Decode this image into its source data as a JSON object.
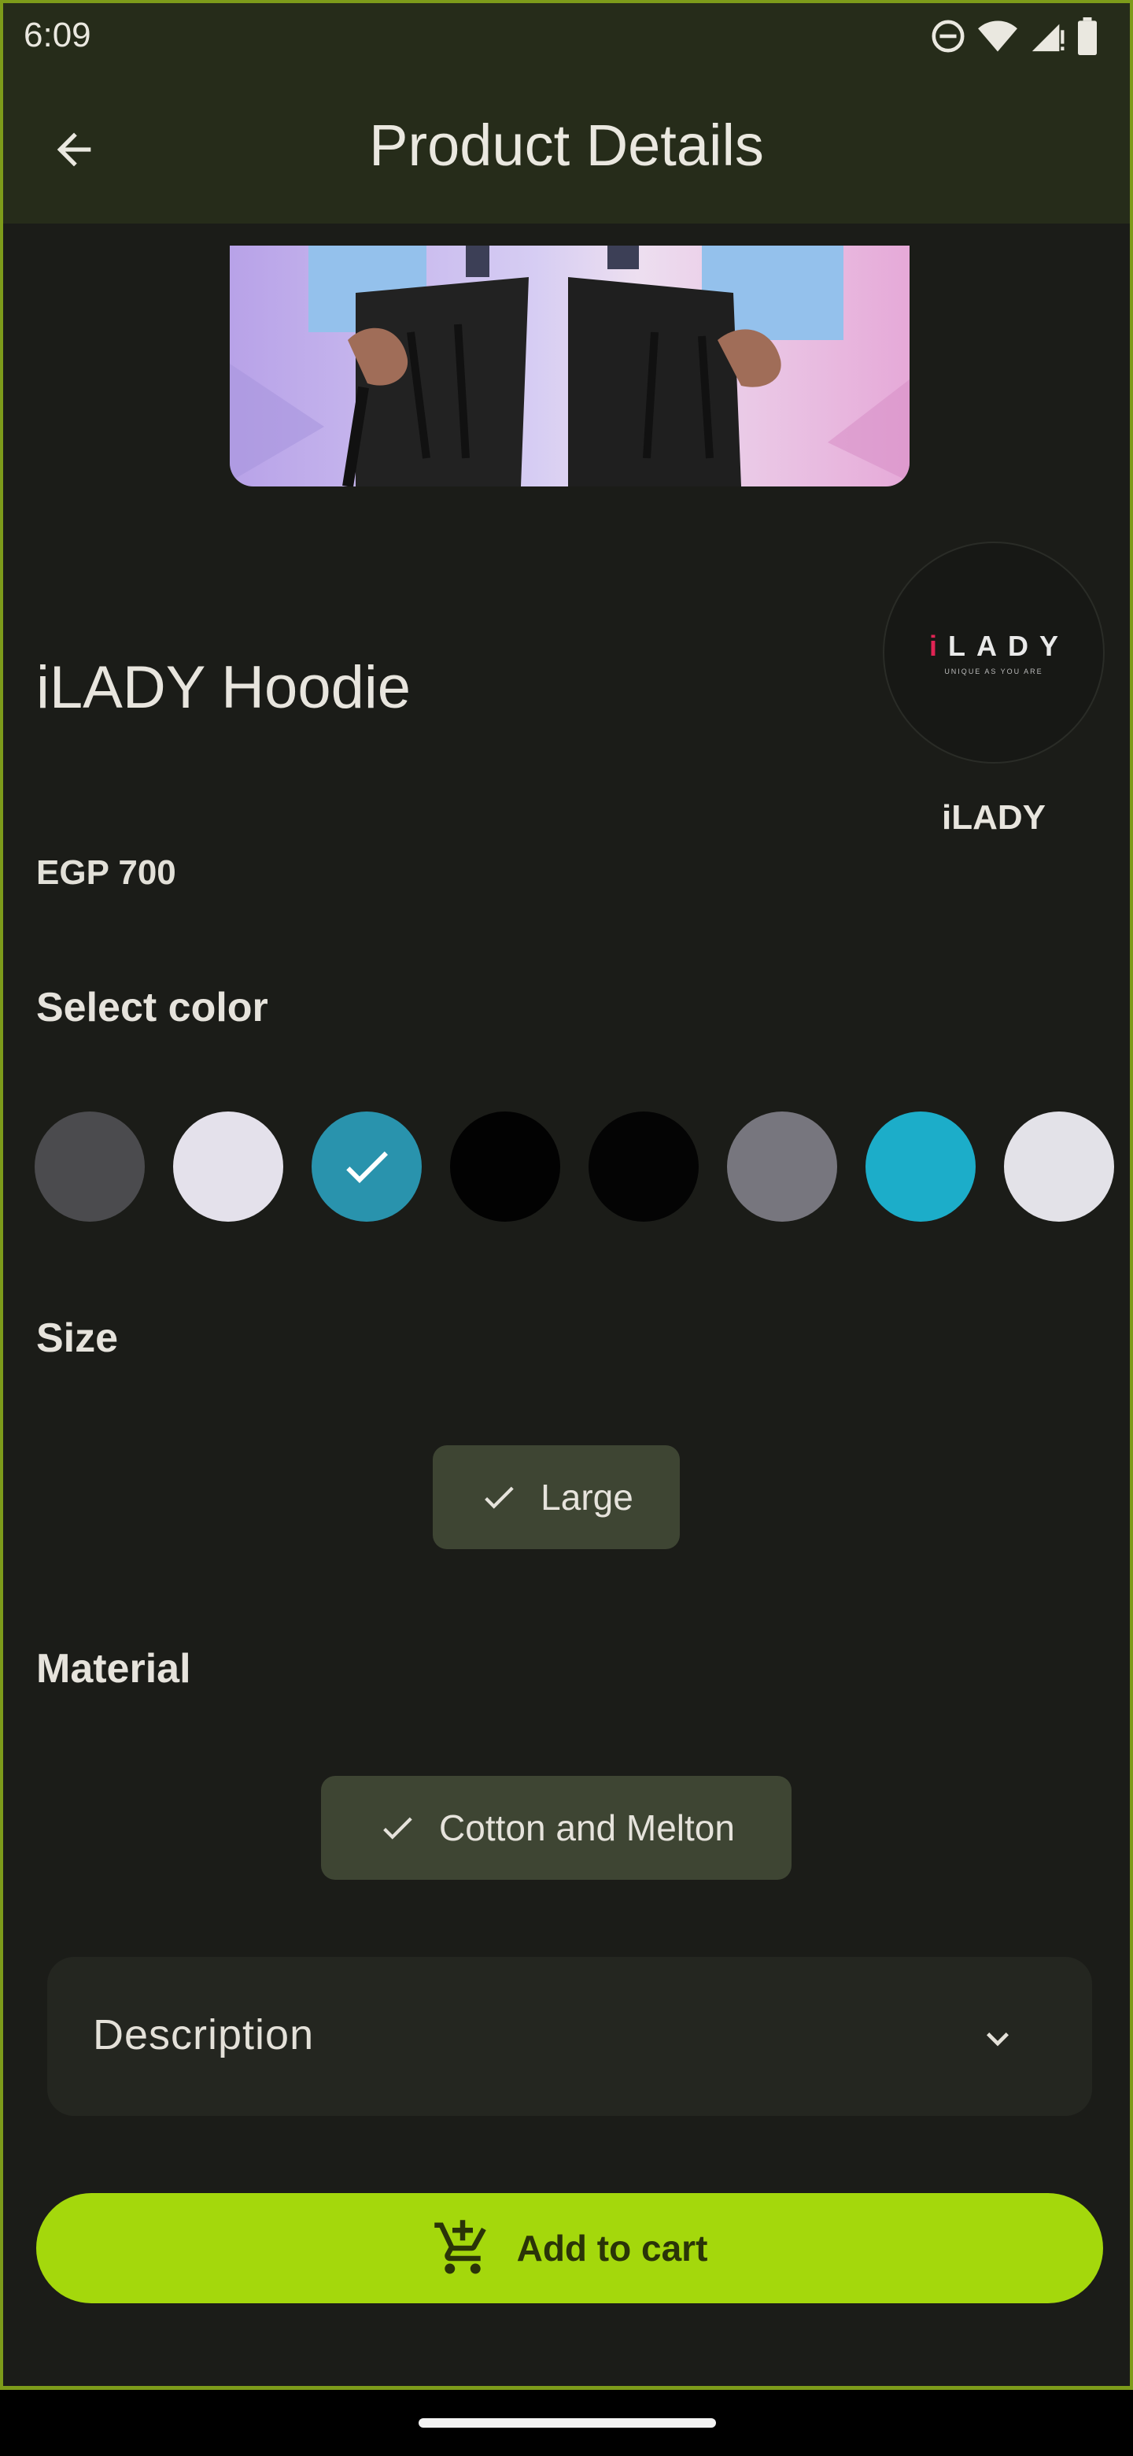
{
  "status": {
    "time": "6:09"
  },
  "app_bar": {
    "title": "Product Details"
  },
  "product": {
    "name": "iLADY Hoodie",
    "price": "EGP 700",
    "brand": {
      "name": "iLADY",
      "logo_text_i": "i",
      "logo_text_rest": "LADY",
      "tagline": "UNIQUE AS YOU ARE"
    }
  },
  "color_section": {
    "label": "Select color",
    "swatches": [
      {
        "color": "#4b4b4e",
        "selected": false
      },
      {
        "color": "#e4e1eb",
        "selected": false
      },
      {
        "color": "#2993ad",
        "selected": true
      },
      {
        "color": "#020202",
        "selected": false
      },
      {
        "color": "#040404",
        "selected": false
      },
      {
        "color": "#77767e",
        "selected": false
      },
      {
        "color": "#1cadc9",
        "selected": false
      },
      {
        "color": "#e3e2e8",
        "selected": false
      }
    ]
  },
  "size_section": {
    "label": "Size",
    "selected": "Large"
  },
  "material_section": {
    "label": "Material",
    "selected": "Cotton and Melton"
  },
  "description": {
    "title": "Description"
  },
  "cart": {
    "label": "Add to cart"
  },
  "colors": {
    "accent": "#a4d80c",
    "app_bar": "#262c1a",
    "chip": "#3e4533",
    "background": "#1b1c18"
  }
}
